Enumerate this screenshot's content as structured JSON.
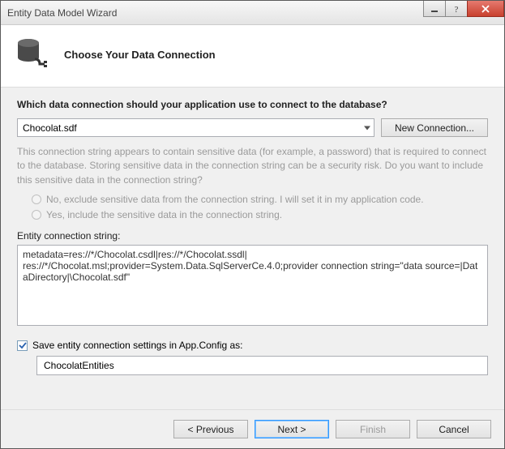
{
  "window": {
    "title": "Entity Data Model Wizard"
  },
  "header": {
    "title": "Choose Your Data Connection"
  },
  "prompt": "Which data connection should your application use to connect to the database?",
  "connection": {
    "selected": "Chocolat.sdf",
    "new_button": "New Connection..."
  },
  "info_text": "This connection string appears to contain sensitive data (for example, a password) that is required to connect to the database. Storing sensitive data in the connection string can be a security risk. Do you want to include this sensitive data in the connection string?",
  "radios": {
    "exclude": "No, exclude sensitive data from the connection string. I will set it in my application code.",
    "include": "Yes, include the sensitive data in the connection string."
  },
  "conn_string": {
    "label": "Entity connection string:",
    "value": "metadata=res://*/Chocolat.csdl|res://*/Chocolat.ssdl|\nres://*/Chocolat.msl;provider=System.Data.SqlServerCe.4.0;provider connection string=\"data source=|DataDirectory|\\Chocolat.sdf\""
  },
  "save_settings": {
    "checked": true,
    "label": "Save entity connection settings in App.Config as:",
    "value": "ChocolatEntities"
  },
  "footer": {
    "previous": "< Previous",
    "next": "Next >",
    "finish": "Finish",
    "cancel": "Cancel"
  }
}
